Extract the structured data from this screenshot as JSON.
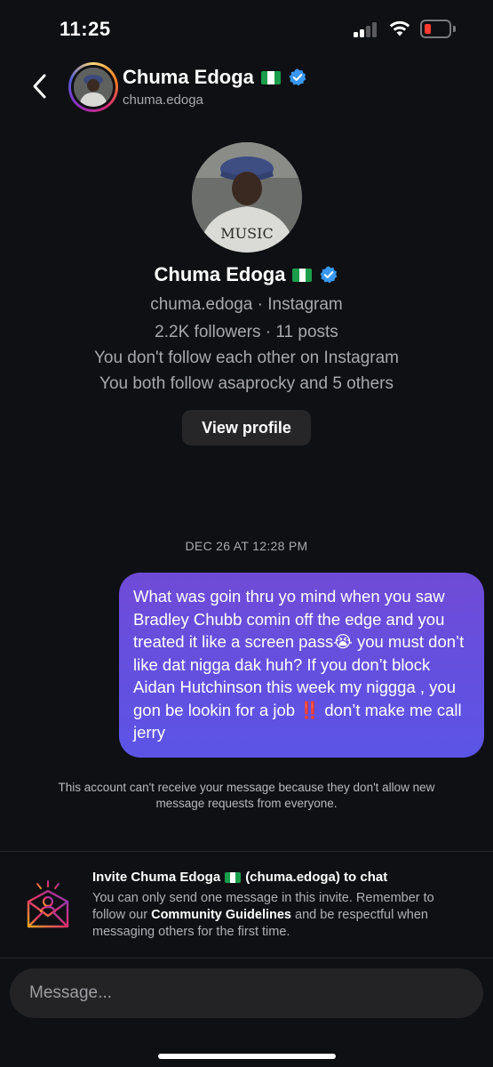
{
  "status_bar": {
    "time": "11:25"
  },
  "header": {
    "name": "Chuma Edoga",
    "username": "chuma.edoga"
  },
  "profile": {
    "name": "Chuma Edoga",
    "subtitle": "chuma.edoga · Instagram",
    "stats": "2.2K followers · 11 posts",
    "follow_status": "You don't follow each other on Instagram",
    "mutuals": "You both follow asaprocky and 5 others",
    "view_profile_label": "View profile"
  },
  "conversation": {
    "timestamp": "DEC 26 AT 12:28 PM",
    "messages": [
      {
        "sender": "me",
        "text": "What was goin thru yo mind when you saw Bradley Chubb comin off the edge and you treated it like a screen pass😭 you must don’t like dat nigga dak huh? If you don’t block Aidan Hutchinson this week my niggga , you gon be lookin for a job ‼️ don’t make me call jerry"
      }
    ],
    "notice": "This account can't receive your message because they don't allow new message requests from everyone."
  },
  "invite": {
    "title_prefix": "Invite Chuma Edoga",
    "title_suffix": "(chuma.edoga) to chat",
    "body_before": "You can only send one message in this invite. Remember to follow our ",
    "body_link": "Community Guidelines",
    "body_after": " and be respectful when messaging others for the first time."
  },
  "composer": {
    "placeholder": "Message..."
  },
  "icons": {
    "back": "chevron-left-icon",
    "verified": "verified-badge-icon",
    "flag": "nigeria-flag-icon",
    "invite": "invite-envelope-icon",
    "signal": "cellular-signal-icon",
    "wifi": "wifi-icon",
    "battery": "battery-low-icon"
  },
  "colors": {
    "background": "#0f1014",
    "bubble_top": "#6f4bd6",
    "bubble_bottom": "#5b54e6",
    "verified": "#3897f0",
    "battery_low": "#ff3b30",
    "secondary_text": "#a8a8ad"
  }
}
